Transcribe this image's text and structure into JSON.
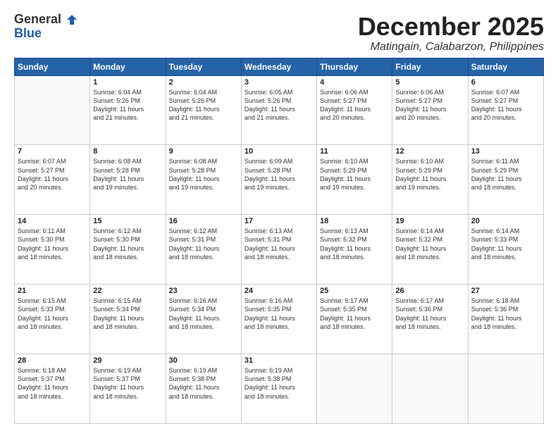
{
  "header": {
    "logo_general": "General",
    "logo_blue": "Blue",
    "month": "December 2025",
    "location": "Matingain, Calabarzon, Philippines"
  },
  "weekdays": [
    "Sunday",
    "Monday",
    "Tuesday",
    "Wednesday",
    "Thursday",
    "Friday",
    "Saturday"
  ],
  "weeks": [
    [
      {
        "day": "",
        "info": ""
      },
      {
        "day": "1",
        "info": "Sunrise: 6:04 AM\nSunset: 5:26 PM\nDaylight: 11 hours\nand 21 minutes."
      },
      {
        "day": "2",
        "info": "Sunrise: 6:04 AM\nSunset: 5:26 PM\nDaylight: 11 hours\nand 21 minutes."
      },
      {
        "day": "3",
        "info": "Sunrise: 6:05 AM\nSunset: 5:26 PM\nDaylight: 11 hours\nand 21 minutes."
      },
      {
        "day": "4",
        "info": "Sunrise: 6:06 AM\nSunset: 5:27 PM\nDaylight: 11 hours\nand 20 minutes."
      },
      {
        "day": "5",
        "info": "Sunrise: 6:06 AM\nSunset: 5:27 PM\nDaylight: 11 hours\nand 20 minutes."
      },
      {
        "day": "6",
        "info": "Sunrise: 6:07 AM\nSunset: 5:27 PM\nDaylight: 11 hours\nand 20 minutes."
      }
    ],
    [
      {
        "day": "7",
        "info": "Sunrise: 6:07 AM\nSunset: 5:27 PM\nDaylight: 11 hours\nand 20 minutes."
      },
      {
        "day": "8",
        "info": "Sunrise: 6:08 AM\nSunset: 5:28 PM\nDaylight: 11 hours\nand 19 minutes."
      },
      {
        "day": "9",
        "info": "Sunrise: 6:08 AM\nSunset: 5:28 PM\nDaylight: 11 hours\nand 19 minutes."
      },
      {
        "day": "10",
        "info": "Sunrise: 6:09 AM\nSunset: 5:28 PM\nDaylight: 11 hours\nand 19 minutes."
      },
      {
        "day": "11",
        "info": "Sunrise: 6:10 AM\nSunset: 5:29 PM\nDaylight: 11 hours\nand 19 minutes."
      },
      {
        "day": "12",
        "info": "Sunrise: 6:10 AM\nSunset: 5:29 PM\nDaylight: 11 hours\nand 19 minutes."
      },
      {
        "day": "13",
        "info": "Sunrise: 6:11 AM\nSunset: 5:29 PM\nDaylight: 11 hours\nand 18 minutes."
      }
    ],
    [
      {
        "day": "14",
        "info": "Sunrise: 6:11 AM\nSunset: 5:30 PM\nDaylight: 11 hours\nand 18 minutes."
      },
      {
        "day": "15",
        "info": "Sunrise: 6:12 AM\nSunset: 5:30 PM\nDaylight: 11 hours\nand 18 minutes."
      },
      {
        "day": "16",
        "info": "Sunrise: 6:12 AM\nSunset: 5:31 PM\nDaylight: 11 hours\nand 18 minutes."
      },
      {
        "day": "17",
        "info": "Sunrise: 6:13 AM\nSunset: 5:31 PM\nDaylight: 11 hours\nand 18 minutes."
      },
      {
        "day": "18",
        "info": "Sunrise: 6:13 AM\nSunset: 5:32 PM\nDaylight: 11 hours\nand 18 minutes."
      },
      {
        "day": "19",
        "info": "Sunrise: 6:14 AM\nSunset: 5:32 PM\nDaylight: 11 hours\nand 18 minutes."
      },
      {
        "day": "20",
        "info": "Sunrise: 6:14 AM\nSunset: 5:33 PM\nDaylight: 11 hours\nand 18 minutes."
      }
    ],
    [
      {
        "day": "21",
        "info": "Sunrise: 6:15 AM\nSunset: 5:33 PM\nDaylight: 11 hours\nand 18 minutes."
      },
      {
        "day": "22",
        "info": "Sunrise: 6:15 AM\nSunset: 5:34 PM\nDaylight: 11 hours\nand 18 minutes."
      },
      {
        "day": "23",
        "info": "Sunrise: 6:16 AM\nSunset: 5:34 PM\nDaylight: 11 hours\nand 18 minutes."
      },
      {
        "day": "24",
        "info": "Sunrise: 6:16 AM\nSunset: 5:35 PM\nDaylight: 11 hours\nand 18 minutes."
      },
      {
        "day": "25",
        "info": "Sunrise: 6:17 AM\nSunset: 5:35 PM\nDaylight: 11 hours\nand 18 minutes."
      },
      {
        "day": "26",
        "info": "Sunrise: 6:17 AM\nSunset: 5:36 PM\nDaylight: 11 hours\nand 18 minutes."
      },
      {
        "day": "27",
        "info": "Sunrise: 6:18 AM\nSunset: 5:36 PM\nDaylight: 11 hours\nand 18 minutes."
      }
    ],
    [
      {
        "day": "28",
        "info": "Sunrise: 6:18 AM\nSunset: 5:37 PM\nDaylight: 11 hours\nand 18 minutes."
      },
      {
        "day": "29",
        "info": "Sunrise: 6:19 AM\nSunset: 5:37 PM\nDaylight: 11 hours\nand 18 minutes."
      },
      {
        "day": "30",
        "info": "Sunrise: 6:19 AM\nSunset: 5:38 PM\nDaylight: 11 hours\nand 18 minutes."
      },
      {
        "day": "31",
        "info": "Sunrise: 6:19 AM\nSunset: 5:38 PM\nDaylight: 11 hours\nand 18 minutes."
      },
      {
        "day": "",
        "info": ""
      },
      {
        "day": "",
        "info": ""
      },
      {
        "day": "",
        "info": ""
      }
    ]
  ]
}
